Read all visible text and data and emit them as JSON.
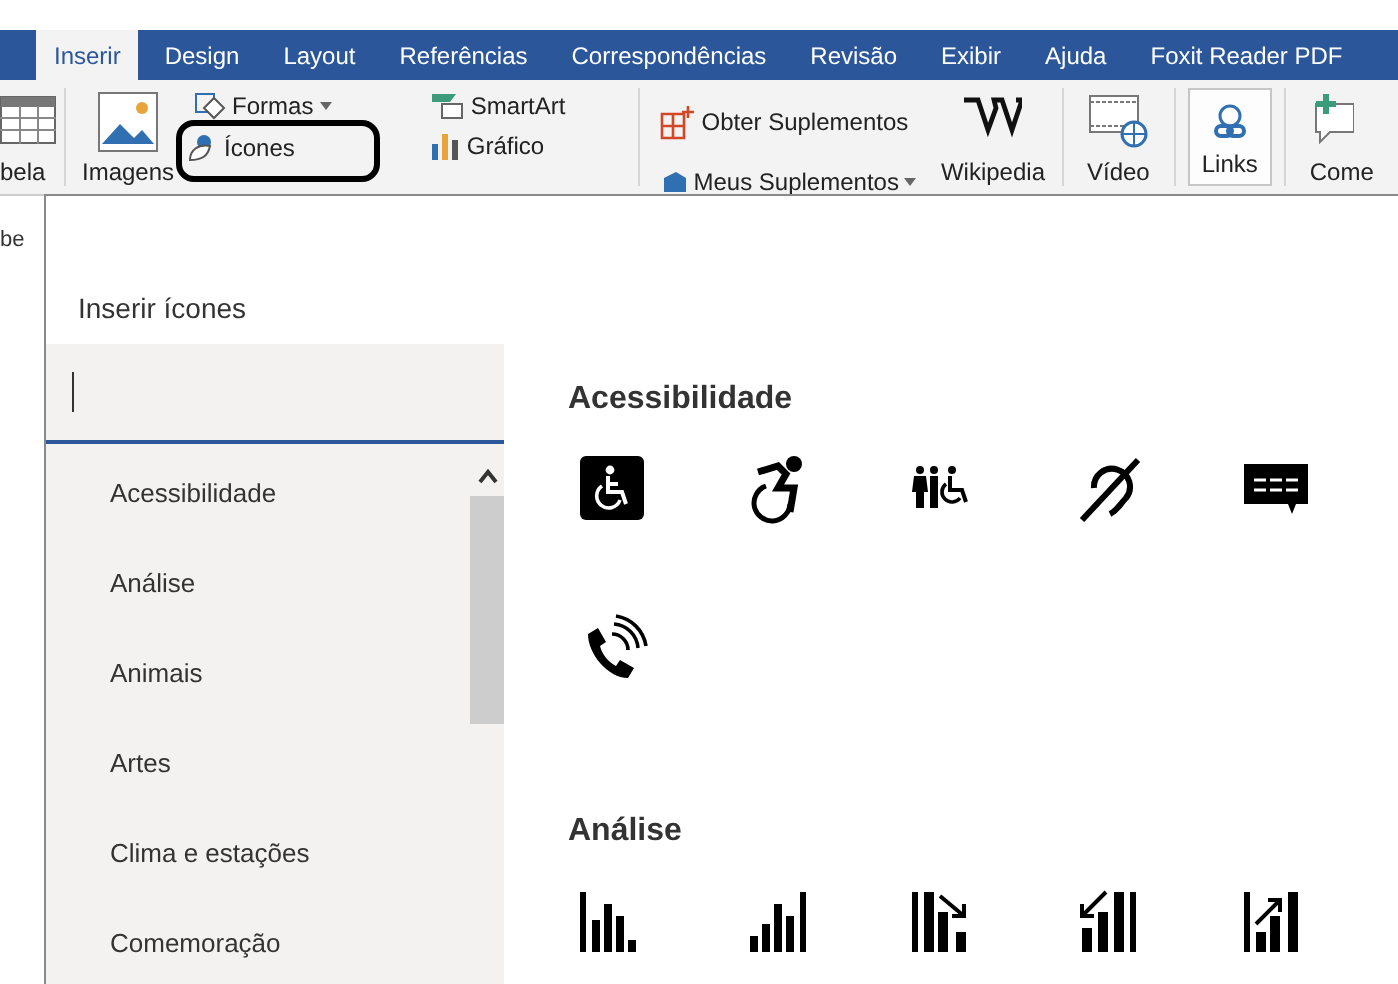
{
  "ribbon_tabs": [
    {
      "label": "Inserir",
      "selected": true
    },
    {
      "label": "Design",
      "selected": false
    },
    {
      "label": "Layout",
      "selected": false
    },
    {
      "label": "Referências",
      "selected": false
    },
    {
      "label": "Correspondências",
      "selected": false
    },
    {
      "label": "Revisão",
      "selected": false
    },
    {
      "label": "Exibir",
      "selected": false
    },
    {
      "label": "Ajuda",
      "selected": false
    },
    {
      "label": "Foxit Reader PDF",
      "selected": false
    }
  ],
  "ribbon": {
    "table_label": "bela",
    "pictures_label": "Imagens",
    "shapes_label": "Formas",
    "icons_label": "Ícones",
    "smartart_label": "SmartArt",
    "chart_label": "Gráfico",
    "get_addins_label": "Obter Suplementos",
    "my_addins_label": "Meus Suplementos",
    "wikipedia_label": "Wikipedia",
    "video_label": "Vídeo",
    "links_label": "Links",
    "comment_label": "Come",
    "left_edge_text": "be",
    "icons_highlighted": true
  },
  "dialog": {
    "title": "Inserir ícones",
    "search": {
      "focused": true
    },
    "categories": [
      {
        "label": "Acessibilidade"
      },
      {
        "label": "Análise"
      },
      {
        "label": "Animais"
      },
      {
        "label": "Artes"
      },
      {
        "label": "Clima e estações"
      },
      {
        "label": "Comemoração"
      }
    ],
    "sections": [
      {
        "heading": "Acessibilidade",
        "icons": [
          {
            "kind": "wheelchair-sign"
          },
          {
            "kind": "active-wheelchair"
          },
          {
            "kind": "people"
          },
          {
            "kind": "deaf"
          },
          {
            "kind": "caption"
          },
          {
            "kind": "phone"
          }
        ]
      },
      {
        "heading": "Análise",
        "icons": [
          {
            "kind": "bars-a"
          },
          {
            "kind": "bars-up"
          },
          {
            "kind": "bars-down"
          },
          {
            "kind": "bars-arrow-left"
          },
          {
            "kind": "bars-arrow-up"
          }
        ]
      }
    ]
  }
}
